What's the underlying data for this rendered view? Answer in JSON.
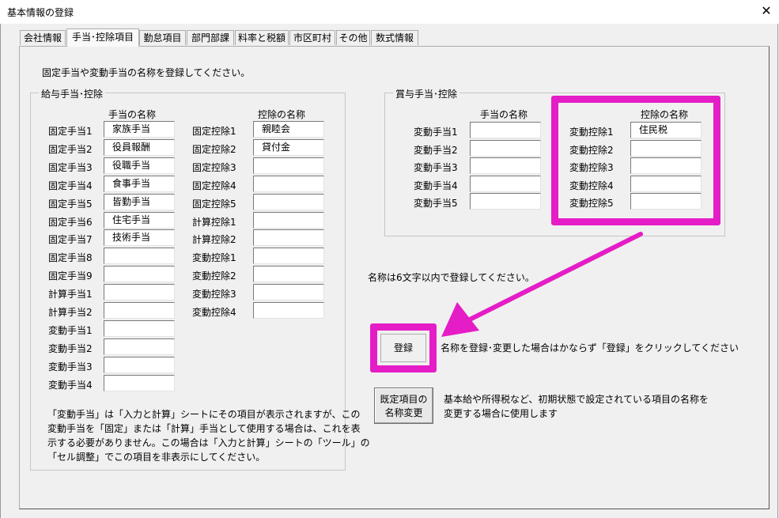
{
  "window": {
    "title": "基本情報の登録",
    "close_glyph": "✕"
  },
  "tabs": [
    {
      "label": "会社情報"
    },
    {
      "label": "手当･控除項目",
      "active": true
    },
    {
      "label": "勤怠項目"
    },
    {
      "label": "部門部課"
    },
    {
      "label": "料率と税額"
    },
    {
      "label": "市区町村"
    },
    {
      "label": "その他"
    },
    {
      "label": "数式情報"
    }
  ],
  "instruction": "固定手当や変動手当の名称を登録してください。",
  "salary_group": {
    "label": "給与手当･控除",
    "allowance_header": "手当の名称",
    "deduction_header": "控除の名称",
    "allowances": [
      {
        "label": "固定手当1",
        "value": "家族手当"
      },
      {
        "label": "固定手当2",
        "value": "役員報酬"
      },
      {
        "label": "固定手当3",
        "value": "役職手当"
      },
      {
        "label": "固定手当4",
        "value": "食事手当"
      },
      {
        "label": "固定手当5",
        "value": "皆勤手当"
      },
      {
        "label": "固定手当6",
        "value": "住宅手当"
      },
      {
        "label": "固定手当7",
        "value": "技術手当"
      },
      {
        "label": "固定手当8",
        "value": ""
      },
      {
        "label": "固定手当9",
        "value": ""
      },
      {
        "label": "計算手当1",
        "value": ""
      },
      {
        "label": "計算手当2",
        "value": ""
      },
      {
        "label": "変動手当1",
        "value": ""
      },
      {
        "label": "変動手当2",
        "value": ""
      },
      {
        "label": "変動手当3",
        "value": ""
      },
      {
        "label": "変動手当4",
        "value": ""
      }
    ],
    "deductions": [
      {
        "label": "固定控除1",
        "value": "親睦会"
      },
      {
        "label": "固定控除2",
        "value": "貸付金"
      },
      {
        "label": "固定控除3",
        "value": ""
      },
      {
        "label": "固定控除4",
        "value": ""
      },
      {
        "label": "固定控除5",
        "value": ""
      },
      {
        "label": "計算控除1",
        "value": ""
      },
      {
        "label": "計算控除2",
        "value": ""
      },
      {
        "label": "変動控除1",
        "value": ""
      },
      {
        "label": "変動控除2",
        "value": ""
      },
      {
        "label": "変動控除3",
        "value": ""
      },
      {
        "label": "変動控除4",
        "value": ""
      }
    ],
    "note_lines": [
      "「変動手当」は「入力と計算」シートにその項目が表示されますが、この",
      "変動手当を「固定」または「計算」手当として使用する場合は、これを表",
      "示する必要がありません。この場合は「入力と計算」シートの「ツール」の",
      "「セル調整」でこの項目を非表示にしてください。"
    ]
  },
  "bonus_group": {
    "label": "賞与手当･控除",
    "allowance_header": "手当の名称",
    "deduction_header": "控除の名称",
    "allowances": [
      {
        "label": "変動手当1",
        "value": ""
      },
      {
        "label": "変動手当2",
        "value": ""
      },
      {
        "label": "変動手当3",
        "value": ""
      },
      {
        "label": "変動手当4",
        "value": ""
      },
      {
        "label": "変動手当5",
        "value": ""
      }
    ],
    "deductions": [
      {
        "label": "変動控除1",
        "value": "住民税"
      },
      {
        "label": "変動控除2",
        "value": ""
      },
      {
        "label": "変動控除3",
        "value": ""
      },
      {
        "label": "変動控除4",
        "value": ""
      },
      {
        "label": "変動控除5",
        "value": ""
      }
    ]
  },
  "length_note": "名称は6文字以内で登録してください。",
  "register": {
    "label": "登録",
    "note": "名称を登録･変更した場合はかならず「登録」をクリックしてください"
  },
  "rename_default": {
    "label_line1": "既定項目の",
    "label_line2": "名称変更",
    "note_line1": "基本給や所得税など、初期状態で設定されている項目の名称を",
    "note_line2": "変更する場合に使用します"
  },
  "colors": {
    "highlight": "#e51dc6",
    "window_bg": "#f0f0f0"
  }
}
